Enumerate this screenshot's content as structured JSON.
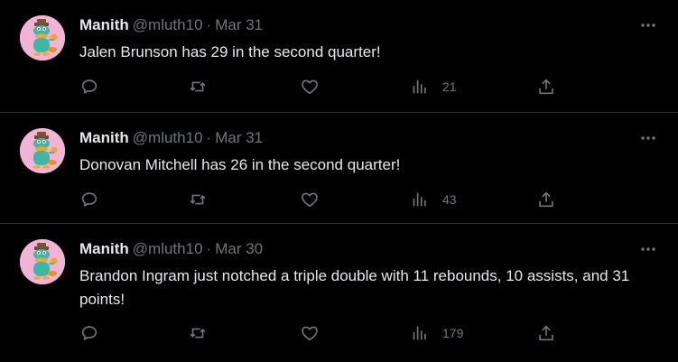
{
  "tweets": [
    {
      "name": "Manith",
      "handle": "@mluth10",
      "separator": "·",
      "date": "Mar 31",
      "text": "Jalen Brunson has 29 in the second quarter!",
      "views": "21",
      "avatar_icon": "perry-the-platypus-avatar"
    },
    {
      "name": "Manith",
      "handle": "@mluth10",
      "separator": "·",
      "date": "Mar 31",
      "text": "Donovan Mitchell has 26 in the second quarter!",
      "views": "43",
      "avatar_icon": "perry-the-platypus-avatar"
    },
    {
      "name": "Manith",
      "handle": "@mluth10",
      "separator": "·",
      "date": "Mar 30",
      "text": "Brandon Ingram just notched a triple double with 11 rebounds, 10 assists, and 31 points!",
      "views": "179",
      "avatar_icon": "perry-the-platypus-avatar"
    }
  ],
  "icons": {
    "more": "more-horizontal-icon",
    "reply": "reply-icon",
    "retweet": "retweet-icon",
    "like": "heart-icon",
    "views": "views-chart-icon",
    "share": "share-icon"
  },
  "colors": {
    "background": "#000000",
    "primary_text": "#e7e9ea",
    "secondary_text": "#71767b",
    "divider": "#2f3336",
    "avatar_bg": "#f2b3d7",
    "platypus_teal": "#3fb7a7",
    "beak_orange": "#f5a623"
  }
}
